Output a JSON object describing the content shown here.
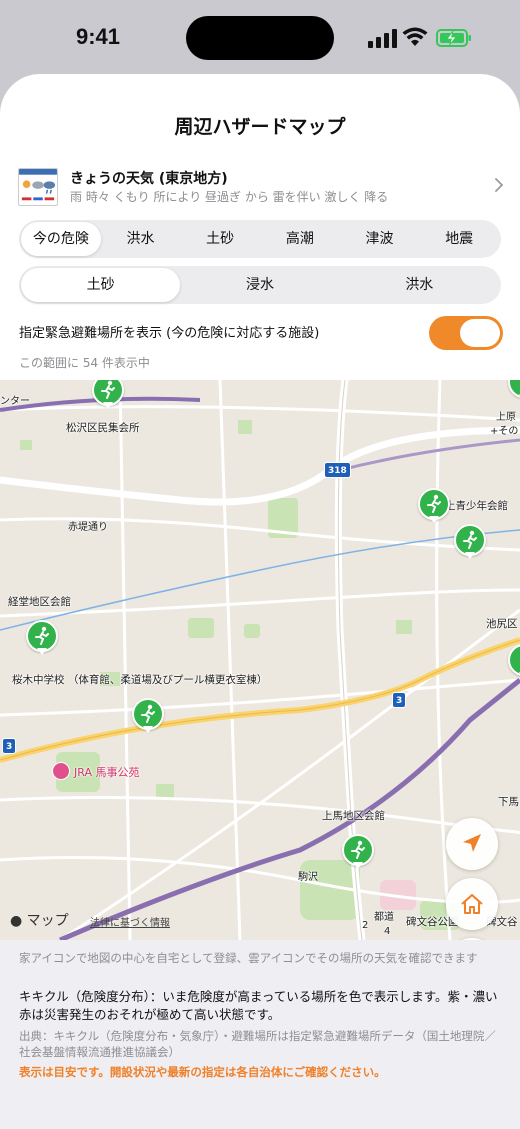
{
  "status_bar": {
    "time": "9:41"
  },
  "sheet": {
    "title": "周辺ハザードマップ"
  },
  "weather": {
    "title": "きょうの天気 (東京地方)",
    "forecast": "雨 時々 くもり 所により 昼過ぎ から 雷を伴い 激しく 降る",
    "thumb_icon": "weather-forecast-thumbnail-icon"
  },
  "hazard_tabs": {
    "items": [
      "今の危険",
      "洪水",
      "土砂",
      "高潮",
      "津波",
      "地震"
    ],
    "selected": "今の危険"
  },
  "sub_tabs": {
    "items": [
      "土砂",
      "浸水",
      "洪水"
    ],
    "selected": "土砂"
  },
  "shelter_toggle": {
    "label": "指定緊急避難場所を表示 (今の危険に対応する施設)",
    "on": true,
    "color": "#f0892a"
  },
  "result_count": "この範囲に 54 件表示中",
  "map": {
    "labels": {
      "center_left": "ンター",
      "matsuzawa": "松沢区民集会所",
      "kamihara": "上原",
      "sono": "+その",
      "ikenoue": "池之上青少年会館",
      "akatsutsumi": "赤堤通り",
      "kyodo": "経堂地区会館",
      "ikejiri": "池尻区",
      "sakuragi": "桜木中学校 （体育館、柔道場及びプール横更衣室棟）",
      "jra": "JRA 馬事公苑",
      "kamiuma": "上馬地区会館",
      "shimouma": "下馬",
      "komazawa": "駒沢",
      "himonya": "碑文谷公園",
      "himonya2": "碑文谷",
      "toritsu": "都道",
      "n4": "4",
      "n2": "2"
    },
    "route_shields": [
      "318",
      "3",
      "3"
    ],
    "cluster_count": "2",
    "maps_logo": " マップ",
    "legal": "法律に基づく情報",
    "pin_color": "#31b24a",
    "icons": [
      "running-person-icon",
      "location-arrow-icon",
      "home-icon",
      "weather-sun-cloud-icon"
    ]
  },
  "footer": {
    "hint": "家アイコンで地図の中心を自宅として登録、雲アイコンでその場所の天気を確認できます",
    "kikikuru": "キキクル（危険度分布）：いま危険度が高まっている場所を色で表示します。紫・濃い赤は災害発生のおそれが極めて高い状態です。",
    "source": "出典：キキクル（危険度分布・気象庁）・避難場所は指定緊急避難場所データ（国土地理院／社会基盤情報流通推進協議会）",
    "notice": "表示は目安です。開設状況や最新の指定は各自治体にご確認ください。",
    "notice_color": "#f0802a"
  }
}
